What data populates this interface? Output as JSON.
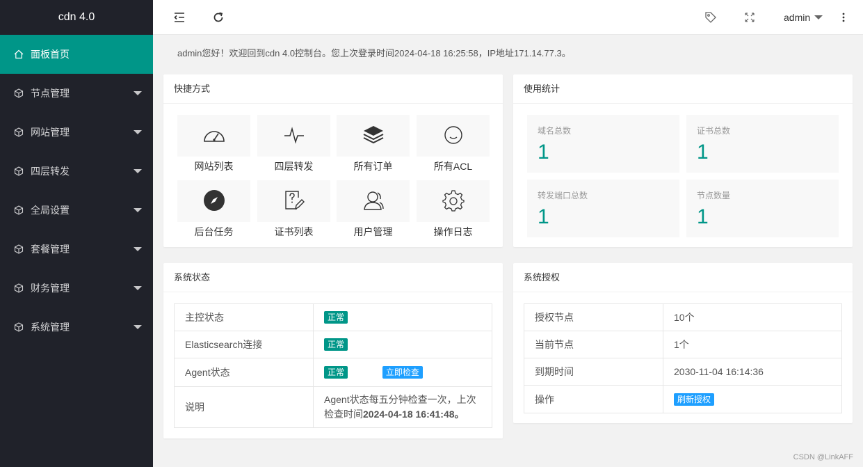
{
  "app": {
    "title": "cdn 4.0"
  },
  "sidebar": {
    "items": [
      {
        "label": "面板首页",
        "icon": "home-icon",
        "active": true
      },
      {
        "label": "节点管理",
        "icon": "cube-icon"
      },
      {
        "label": "网站管理",
        "icon": "cube-icon"
      },
      {
        "label": "四层转发",
        "icon": "cube-icon"
      },
      {
        "label": "全局设置",
        "icon": "cube-icon"
      },
      {
        "label": "套餐管理",
        "icon": "cube-icon"
      },
      {
        "label": "财务管理",
        "icon": "cube-icon"
      },
      {
        "label": "系统管理",
        "icon": "cube-icon"
      }
    ]
  },
  "header": {
    "user": "admin"
  },
  "welcome": "admin您好！欢迎回到cdn 4.0控制台。您上次登录时间2024-04-18 16:25:58，IP地址171.14.77.3。",
  "shortcuts": {
    "title": "快捷方式",
    "items": [
      {
        "label": "网站列表",
        "icon": "dashboard-icon"
      },
      {
        "label": "四层转发",
        "icon": "pulse-icon"
      },
      {
        "label": "所有订单",
        "icon": "layers-icon"
      },
      {
        "label": "所有ACL",
        "icon": "face-icon"
      },
      {
        "label": "后台任务",
        "icon": "compass-icon"
      },
      {
        "label": "证书列表",
        "icon": "edit-icon"
      },
      {
        "label": "用户管理",
        "icon": "user-icon"
      },
      {
        "label": "操作日志",
        "icon": "gear-icon"
      }
    ]
  },
  "usage": {
    "title": "使用统计",
    "stats": [
      {
        "label": "域名总数",
        "value": "1"
      },
      {
        "label": "证书总数",
        "value": "1"
      },
      {
        "label": "转发端口总数",
        "value": "1"
      },
      {
        "label": "节点数量",
        "value": "1"
      }
    ]
  },
  "system_status": {
    "title": "系统状态",
    "rows": {
      "master_label": "主控状态",
      "master_status": "正常",
      "es_label": "Elasticsearch连接",
      "es_status": "正常",
      "agent_label": "Agent状态",
      "agent_status": "正常",
      "check_now": "立即检查",
      "note_label": "说明",
      "note_text": "Agent状态每五分钟检查一次，上次检查时间",
      "note_time": "2024-04-18 16:41:48。"
    }
  },
  "license": {
    "title": "系统授权",
    "rows": {
      "nodes_label": "授权节点",
      "nodes_value": "10个",
      "current_label": "当前节点",
      "current_value": "1个",
      "expire_label": "到期时间",
      "expire_value": "2030-11-04 16:14:36",
      "action_label": "操作",
      "refresh": "刷新授权"
    }
  },
  "watermark": "CSDN @LinkAFF",
  "colors": {
    "accent": "#009688",
    "sidebar": "#20222a",
    "blue": "#1e9fff"
  }
}
